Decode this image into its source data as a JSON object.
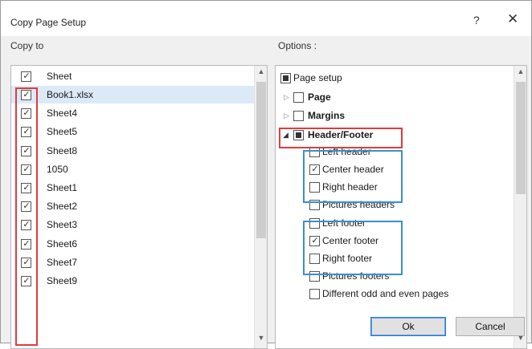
{
  "dialog": {
    "title": "Copy Page Setup",
    "help": "?",
    "close": "✕"
  },
  "copy_to": {
    "label": "Copy to",
    "header": "Sheet",
    "selected_item": "Book1.xlsx",
    "items": [
      "Book1.xlsx",
      "Sheet4",
      "Sheet5",
      "Sheet8",
      "1050",
      "Sheet1",
      "Sheet2",
      "Sheet3",
      "Sheet6",
      "Sheet7",
      "Sheet9"
    ]
  },
  "options": {
    "label": "Options :",
    "page_setup": "Page setup",
    "page": "Page",
    "margins": "Margins",
    "header_footer": "Header/Footer",
    "left_header": "Left header",
    "center_header": "Center header",
    "right_header": "Right header",
    "pictures_headers": "Pictures headers",
    "left_footer": "Left footer",
    "center_footer": "Center footer",
    "right_footer": "Right footer",
    "pictures_footers": "Pictures footers",
    "different_odd_even": "Different odd and even pages"
  },
  "buttons": {
    "ok": "Ok",
    "cancel": "Cancel"
  },
  "colors": {
    "highlight_red": "#e03c3c",
    "highlight_blue": "#3a8fd0",
    "selection": "#dce9f7"
  }
}
